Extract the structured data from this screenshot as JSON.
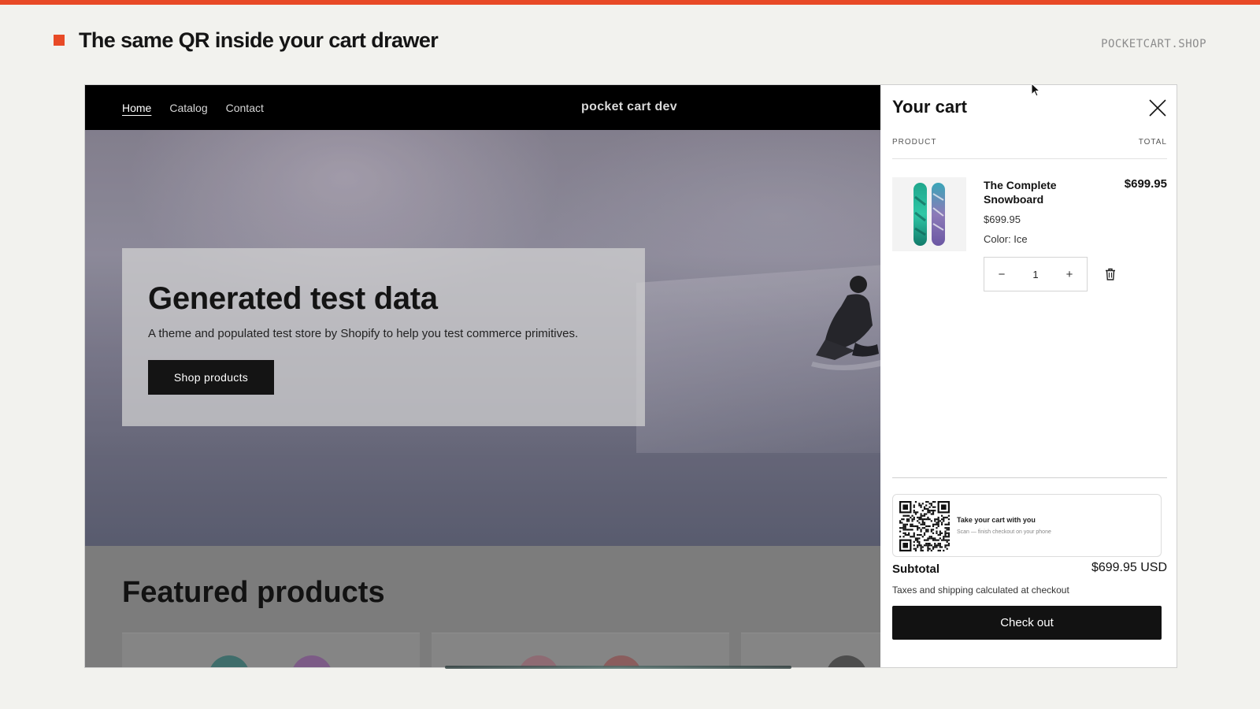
{
  "slide": {
    "title": "The same QR inside your cart drawer",
    "url": "POCKETCART.SHOP",
    "accent_color": "#e84a26"
  },
  "store": {
    "nav": [
      {
        "label": "Home",
        "active": true
      },
      {
        "label": "Catalog",
        "active": false
      },
      {
        "label": "Contact",
        "active": false
      }
    ],
    "name": "pocket cart dev",
    "hero": {
      "title": "Generated test data",
      "subtitle": "A theme and populated test store by Shopify to help you test commerce primitives.",
      "button": "Shop products"
    },
    "featured_title": "Featured products"
  },
  "cart": {
    "title": "Your cart",
    "close_icon": "close-icon",
    "col_product": "PRODUCT",
    "col_total": "TOTAL",
    "item": {
      "name": "The Complete Snowboard",
      "total": "$699.95",
      "price": "$699.95",
      "variant": "Color: Ice",
      "quantity": "1",
      "minus": "−",
      "plus": "+"
    },
    "qr": {
      "title": "Take your cart with you",
      "subtitle": "Scan — finish checkout on your phone"
    },
    "subtotal_label": "Subtotal",
    "subtotal_value": "$699.95 USD",
    "tax_note": "Taxes and shipping calculated at checkout",
    "checkout": "Check out"
  }
}
